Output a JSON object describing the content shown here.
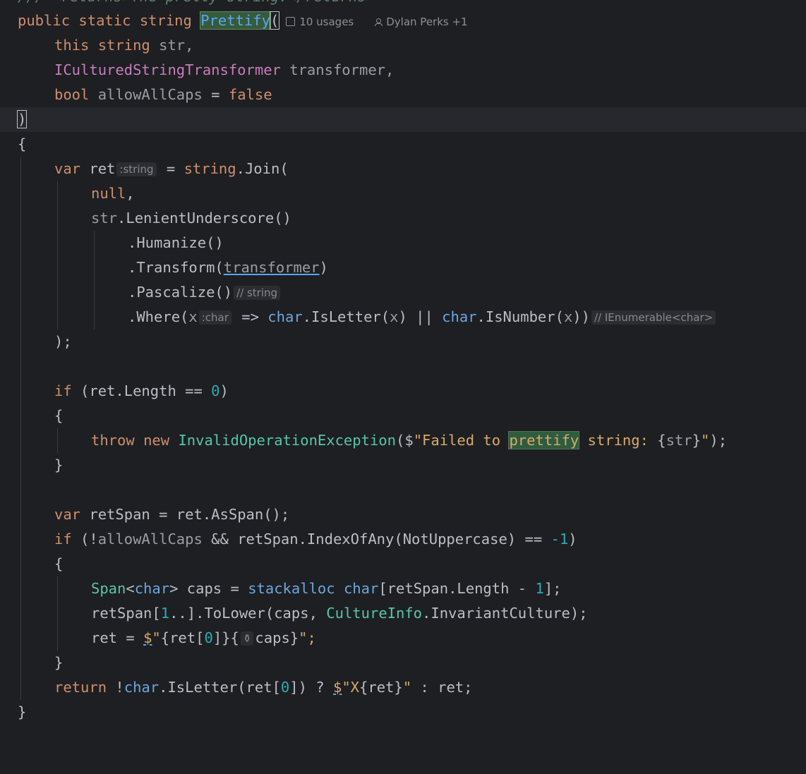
{
  "top_comment": "/// <returns>The pretty string.</returns>",
  "signature": {
    "kw_public": "public",
    "kw_static": "static",
    "kw_string": "string",
    "method_name": "Prettify",
    "paren": "(",
    "usages": "10 usages",
    "authors": "Dylan Perks +1"
  },
  "params": {
    "p1_this": "this",
    "p1_type": "string",
    "p1_name": "str,",
    "p2_type": "ICulturedStringTransformer",
    "p2_name": "transformer,",
    "p3_type": "bool",
    "p3_name": "allowAllCaps",
    "p3_eq": " = ",
    "p3_val": "false"
  },
  "close_paren": ")",
  "open_brace": "{",
  "body": {
    "var": "var",
    "ret": "ret",
    "ret_hint": ":string",
    "join_pre": " = ",
    "join_type": "string",
    "join_call": ".Join(",
    "null": "null",
    "comma": ",",
    "str": "str",
    "lenient": ".LenientUnderscore()",
    "humanize": ".Humanize()",
    "transform_pre": ".Transform(",
    "transform_arg": "transformer",
    "transform_post": ")",
    "pascalize": ".Pascalize()",
    "pascalize_hint": "// string",
    "where_pre": ".Where(",
    "where_x": "x",
    "where_hint": ":char",
    "where_arrow": " => ",
    "char1": "char",
    "isletter": ".IsLetter(",
    "x1": "x",
    "or": ") || ",
    "char2": "char",
    "isnumber": ".IsNumber(",
    "x2": "x",
    "where_close": "))",
    "where_hint2": "// IEnumerable<char>",
    "join_close": ");",
    "if1": "if",
    "if1_cond": " (ret.Length == ",
    "zero": "0",
    "if1_close": ")",
    "brace_open1": "{",
    "throw": "throw",
    "new": "new",
    "exc": "InvalidOperationException",
    "exc_open": "($",
    "msg1": "\"Failed to ",
    "msg_hl": "prettify",
    "msg2": " string: ",
    "interp_open": "{",
    "interp_var": "str",
    "interp_close": "}",
    "msg_end": "\"",
    "exc_close": ");",
    "brace_close1": "}",
    "var2": "var",
    "retspan_decl": " retSpan = ret.AsSpan();",
    "if2": "if",
    "if2_a": " (!",
    "if2_allow": "allowAllCaps",
    "if2_b": " && retSpan.IndexOfAny(NotUppercase) == ",
    "neg1": "-1",
    "if2_c": ")",
    "brace_open2": "{",
    "span_type": "Span",
    "lt": "<",
    "span_char": "char",
    "gt": ">",
    "caps_decl": " caps = ",
    "stackalloc": "stackalloc",
    "sa_char": "char",
    "sa_rest": "[retSpan.Length - ",
    "one": "1",
    "sa_end": "];",
    "tolower_pre": "retSpan[",
    "range_one": "1",
    "tolower_mid": "..].ToLower(caps, ",
    "culture": "CultureInfo",
    "invariant": ".InvariantCulture);",
    "ret_assign": "ret = ",
    "dollar": "$",
    "q1": "\"",
    "i1": "{ret[",
    "i1_zero": "0",
    "i1_close": "]}{",
    "caps": "caps",
    "i2_close": "}",
    "q2": "\";",
    "brace_close2": "}",
    "return": "return",
    "ret_expr_a": " !",
    "ret_char": "char",
    "ret_expr_b": ".IsLetter(ret[",
    "ret_zero": "0",
    "ret_expr_c": "]) ? ",
    "ret_dollar": "$",
    "ret_q": "\"X",
    "ret_interp": "{ret}",
    "ret_q2": "\"",
    "ret_expr_d": " : ret;"
  },
  "close_brace": "}"
}
